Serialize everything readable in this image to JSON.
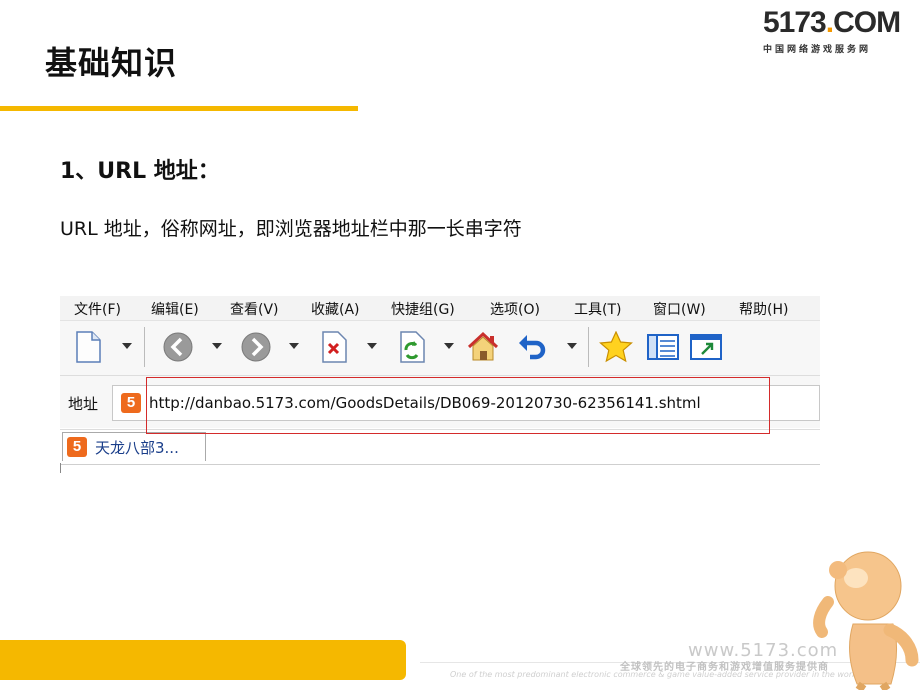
{
  "slide": {
    "title": "基础知识",
    "section_heading": "1、URL 地址：",
    "description": "URL 地址，俗称网址，即浏览器地址栏中那一长串字符"
  },
  "logo": {
    "main_prefix": "5173",
    "main_dot": ".",
    "main_suffix": "COM",
    "subtitle": "中国网络游戏服务网"
  },
  "browser": {
    "menu": [
      "文件(F)",
      "编辑(E)",
      "查看(V)",
      "收藏(A)",
      "快捷组(G)",
      "选项(O)",
      "工具(T)",
      "窗口(W)",
      "帮助(H)"
    ],
    "toolbar_icons": [
      "new-page-icon",
      "back-icon",
      "forward-icon",
      "stop-icon",
      "refresh-icon",
      "home-icon",
      "undo-icon",
      "favorites-star-icon",
      "list-icon",
      "window-icon"
    ],
    "address_label": "地址",
    "url": "http://danbao.5173.com/GoodsDetails/DB069-20120730-62356141.shtml",
    "favicon_text": "5",
    "tab_label": "天龙八部3..."
  },
  "footer": {
    "url": "www.5173.com",
    "tagline_cn": "全球领先的电子商务和游戏增值服务提供商",
    "tagline_en": "One of the most predominant electronic commerce & game value-added service provider in the world"
  },
  "colors": {
    "accent_yellow": "#f5b800",
    "highlight_red": "#d42b2b",
    "favicon_orange": "#ee6a1d"
  }
}
